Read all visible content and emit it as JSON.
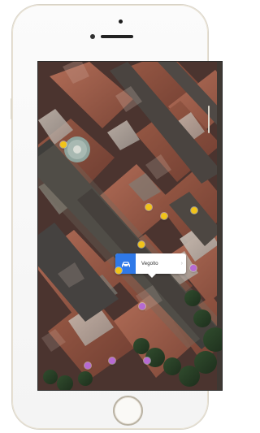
{
  "callout": {
    "label": "Vegolto",
    "chevron": "›",
    "icon": "car-icon"
  },
  "colors": {
    "accent_blue": "#2f79e8",
    "yellow_pin": "#f1c31a",
    "purple_pin": "#b66ad2"
  }
}
